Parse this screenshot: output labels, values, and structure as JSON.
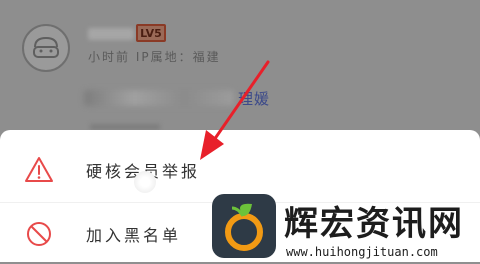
{
  "post": {
    "level_badge": "LV5",
    "meta_text": "小时前 IP属地：福建",
    "content_link": "理媛"
  },
  "menu": {
    "items": [
      {
        "label": "硬核会员举报",
        "icon": "warning-triangle-icon"
      },
      {
        "label": "加入黑名单",
        "icon": "block-circle-icon"
      }
    ]
  },
  "watermark": {
    "title": "辉宏资讯网",
    "url": "www.huihongjituan.com"
  },
  "colors": {
    "overlay": "#8f8f8f",
    "sheet": "#ffffff",
    "arrow": "#e8202a",
    "badge": "#8a3a26",
    "link": "#3c4a8a",
    "logo_bg": "#2e3a46",
    "logo_orange": "#f29a14",
    "logo_leaf": "#6cc23a"
  }
}
